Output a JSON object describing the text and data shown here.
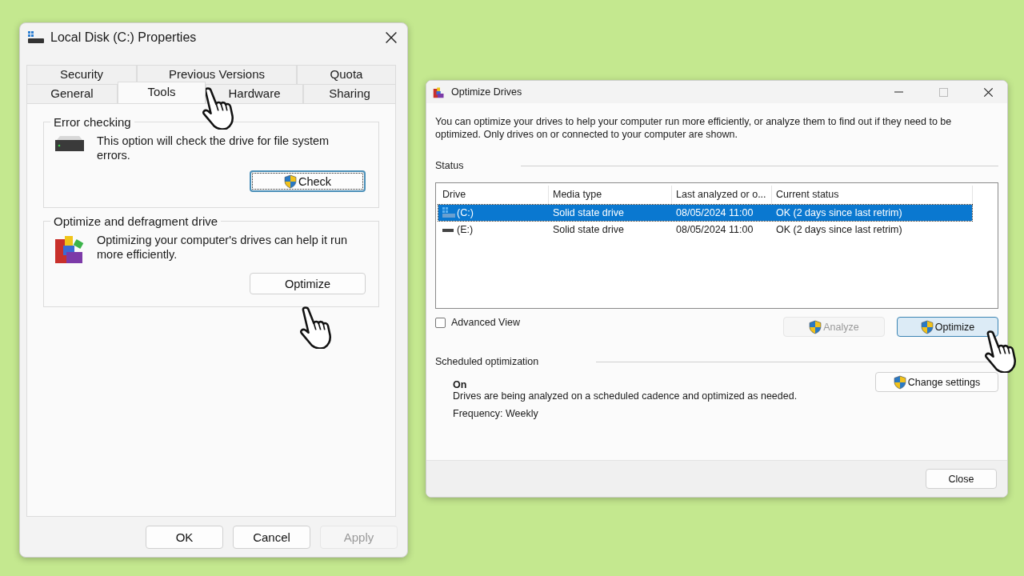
{
  "properties_window": {
    "title": "Local Disk (C:) Properties",
    "tab_rows": [
      [
        {
          "label": "Security",
          "selected": false
        },
        {
          "label": "Previous Versions",
          "selected": false
        },
        {
          "label": "Quota",
          "selected": false
        }
      ],
      [
        {
          "label": "General",
          "selected": false
        },
        {
          "label": "Tools",
          "selected": true
        },
        {
          "label": "Hardware",
          "selected": false
        },
        {
          "label": "Sharing",
          "selected": false
        }
      ]
    ],
    "groups": [
      {
        "kind": "error_checking",
        "heading": "Error checking",
        "description": "This option will check the drive for file system errors.",
        "button": {
          "label": "Check",
          "focused": true,
          "elevated": true
        }
      },
      {
        "kind": "optimize",
        "heading": "Optimize and defragment drive",
        "description": "Optimizing your computer's drives can help it run more efficiently.",
        "button": {
          "label": "Optimize",
          "focused": false,
          "elevated": false
        }
      }
    ],
    "buttons": [
      {
        "label": "OK",
        "disabled": false
      },
      {
        "label": "Cancel",
        "disabled": false
      },
      {
        "label": "Apply",
        "disabled": true
      }
    ]
  },
  "optimize_window": {
    "title": "Optimize Drives",
    "intro": "You can optimize your drives to help your computer run more efficiently, or analyze them to find out if they need to be optimized. Only drives on or connected to your computer are shown.",
    "status_heading": "Status",
    "table": {
      "columns": [
        "Drive",
        "Media type",
        "Last analyzed or o...",
        "Current status"
      ],
      "rows": [
        {
          "kind": "system",
          "selected": true,
          "cells": [
            "(C:)",
            "Solid state drive",
            "08/05/2024 11:00",
            "OK (2 days since last retrim)"
          ]
        },
        {
          "kind": "drive",
          "selected": false,
          "cells": [
            "(E:)",
            "Solid state drive",
            "08/05/2024 11:00",
            "OK (2 days since last retrim)"
          ]
        }
      ]
    },
    "advanced_view": {
      "label": "Advanced View",
      "checked": false
    },
    "actions": [
      {
        "label": "Analyze",
        "disabled": true,
        "highlighted": false
      },
      {
        "label": "Optimize",
        "disabled": false,
        "highlighted": true
      }
    ],
    "scheduled": {
      "heading": "Scheduled optimization",
      "state": "On",
      "description": "Drives are being analyzed on a scheduled cadence and optimized as needed.",
      "frequency": "Frequency: Weekly",
      "button": "Change settings"
    },
    "close_button": "Close"
  }
}
